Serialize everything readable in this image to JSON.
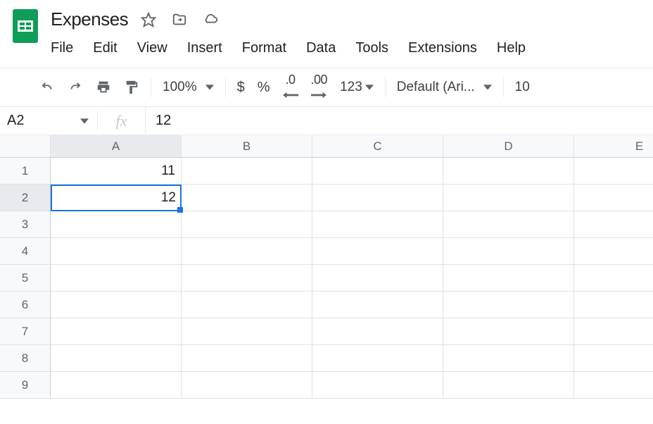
{
  "doc_title": "Expenses",
  "menu": [
    "File",
    "Edit",
    "View",
    "Insert",
    "Format",
    "Data",
    "Tools",
    "Extensions",
    "Help"
  ],
  "toolbar": {
    "zoom": "100%",
    "currency": "$",
    "percent": "%",
    "dec_decrease": ".0",
    "dec_increase": ".00",
    "more_formats": "123",
    "font": "Default (Ari...",
    "font_size": "10"
  },
  "name_box": "A2",
  "fx_label": "fx",
  "formula_value": "12",
  "columns": [
    "A",
    "B",
    "C",
    "D",
    "E"
  ],
  "rows": [
    "1",
    "2",
    "3",
    "4",
    "5",
    "6",
    "7",
    "8",
    "9"
  ],
  "cells": {
    "A1": "11",
    "A2": "12"
  },
  "selected_cell_ref": "A2",
  "selected_col": "A",
  "selected_row": "2"
}
